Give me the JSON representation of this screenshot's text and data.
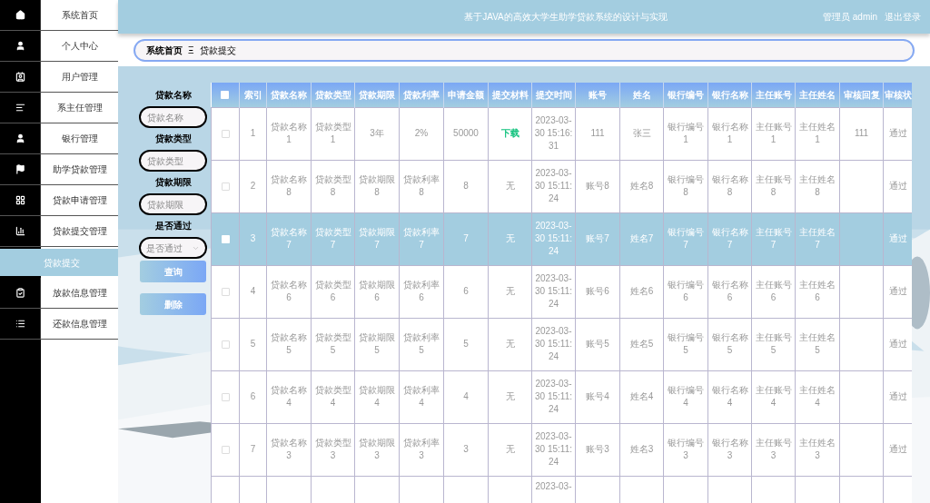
{
  "header": {
    "title": "基于JAVA的高效大学生助学贷款系统的设计与实现",
    "user": "管理员 admin",
    "logout": "退出登录"
  },
  "sidebar": {
    "items": [
      {
        "label": "系统首页",
        "selected": false
      },
      {
        "label": "个人中心",
        "selected": false
      },
      {
        "label": "用户管理",
        "selected": false
      },
      {
        "label": "系主任管理",
        "selected": false
      },
      {
        "label": "银行管理",
        "selected": false
      },
      {
        "label": "助学贷款管理",
        "selected": false
      },
      {
        "label": "贷款申请管理",
        "selected": false
      },
      {
        "label": "贷款提交管理",
        "selected": false
      },
      {
        "label": "贷款提交",
        "selected": true
      },
      {
        "label": "放款信息管理",
        "selected": false
      },
      {
        "label": "还款信息管理",
        "selected": false
      }
    ]
  },
  "breadcrumb": {
    "home": "系统首页",
    "separator": "Ξ",
    "current": "贷款提交"
  },
  "filters": [
    {
      "label": "贷款名称",
      "placeholder": "贷款名称",
      "kind": "input"
    },
    {
      "label": "贷款类型",
      "placeholder": "贷款类型",
      "kind": "input"
    },
    {
      "label": "贷款期限",
      "placeholder": "贷款期限",
      "kind": "input"
    },
    {
      "label": "是否通过",
      "placeholder": "是否通过",
      "kind": "select"
    }
  ],
  "buttons": [
    "查询",
    "删除"
  ],
  "table": {
    "select_all_checked": false,
    "columns": [
      "索引",
      "贷款名称",
      "贷款类型",
      "贷款期限",
      "贷款利率",
      "申请金额",
      "提交材料",
      "提交时间",
      "账号",
      "姓名",
      "银行编号",
      "银行名称",
      "主任账号",
      "主任姓名",
      "审核回复",
      "审核状"
    ],
    "rows": [
      {
        "selected": false,
        "checked": false,
        "cells": [
          "1",
          "贷款名称1",
          "贷款类型1",
          "3年",
          "2%",
          "50000",
          {
            "kind": "link",
            "text": "下载"
          },
          "2023-03-30 15:16:31",
          "111",
          "张三",
          "银行编号1",
          "银行名称1",
          "主任账号1",
          "主任姓名1",
          "111",
          "通过"
        ]
      },
      {
        "selected": false,
        "checked": false,
        "cells": [
          "2",
          "贷款名称8",
          "贷款类型8",
          "贷款期限8",
          "贷款利率8",
          "8",
          {
            "kind": "text",
            "text": "无"
          },
          "2023-03-30 15:11:24",
          "账号8",
          "姓名8",
          "银行编号8",
          "银行名称8",
          "主任账号8",
          "主任姓名8",
          null,
          "通过"
        ]
      },
      {
        "selected": true,
        "checked": false,
        "cells": [
          "3",
          "贷款名称7",
          "贷款类型7",
          "贷款期限7",
          "贷款利率7",
          "7",
          {
            "kind": "text",
            "text": "无"
          },
          "2023-03-30 15:11:24",
          "账号7",
          "姓名7",
          "银行编号7",
          "银行名称7",
          "主任账号7",
          "主任姓名7",
          null,
          "通过"
        ]
      },
      {
        "selected": false,
        "checked": false,
        "cells": [
          "4",
          "贷款名称6",
          "贷款类型6",
          "贷款期限6",
          "贷款利率6",
          "6",
          {
            "kind": "text",
            "text": "无"
          },
          "2023-03-30 15:11:24",
          "账号6",
          "姓名6",
          "银行编号6",
          "银行名称6",
          "主任账号6",
          "主任姓名6",
          null,
          "通过"
        ]
      },
      {
        "selected": false,
        "checked": false,
        "cells": [
          "5",
          "贷款名称5",
          "贷款类型5",
          "贷款期限5",
          "贷款利率5",
          "5",
          {
            "kind": "text",
            "text": "无"
          },
          "2023-03-30 15:11:24",
          "账号5",
          "姓名5",
          "银行编号5",
          "银行名称5",
          "主任账号5",
          "主任姓名5",
          null,
          "通过"
        ]
      },
      {
        "selected": false,
        "checked": false,
        "cells": [
          "6",
          "贷款名称4",
          "贷款类型4",
          "贷款期限4",
          "贷款利率4",
          "4",
          {
            "kind": "text",
            "text": "无"
          },
          "2023-03-30 15:11:24",
          "账号4",
          "姓名4",
          "银行编号4",
          "银行名称4",
          "主任账号4",
          "主任姓名4",
          null,
          "通过"
        ]
      },
      {
        "selected": false,
        "checked": false,
        "cells": [
          "7",
          "贷款名称3",
          "贷款类型3",
          "贷款期限3",
          "贷款利率3",
          "3",
          {
            "kind": "text",
            "text": "无"
          },
          "2023-03-30 15:11:24",
          "账号3",
          "姓名3",
          "银行编号3",
          "银行名称3",
          "主任账号3",
          "主任姓名3",
          null,
          "通过"
        ]
      },
      {
        "selected": false,
        "cells": [
          null,
          null,
          null,
          null,
          null,
          null,
          null,
          "2023-03-",
          null,
          null,
          null,
          null,
          null,
          null,
          null,
          null
        ]
      }
    ]
  }
}
